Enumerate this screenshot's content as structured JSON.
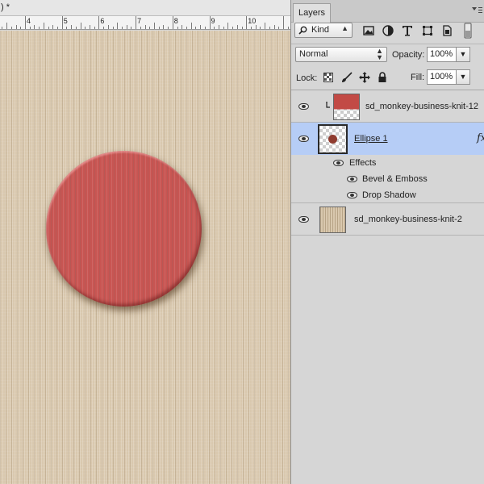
{
  "document": {
    "title_fragment": ") *"
  },
  "ruler": {
    "labels": [
      "4",
      "5",
      "6",
      "7",
      "8",
      "9",
      "10"
    ]
  },
  "panel": {
    "tab_label": "Layers",
    "filter": {
      "kind_label": "Kind"
    },
    "blend_mode": "Normal",
    "opacity_label": "Opacity:",
    "opacity_value": "100%",
    "lock_label": "Lock:",
    "fill_label": "Fill:",
    "fill_value": "100%",
    "layers": [
      {
        "name": "sd_monkey-business-knit-12",
        "clipped": true,
        "selected": false
      },
      {
        "name": "Ellipse 1",
        "selected": true,
        "fx": "fx",
        "effects_label": "Effects",
        "effects": [
          "Bevel & Emboss",
          "Drop Shadow"
        ]
      },
      {
        "name": "sd_monkey-business-knit-2",
        "selected": false
      }
    ]
  },
  "icons": [
    "search-icon",
    "image-filter-icon",
    "adjustment-filter-icon",
    "type-filter-icon",
    "shape-filter-icon",
    "smart-object-filter-icon",
    "filter-toggle-icon",
    "lock-transparent-icon",
    "lock-paint-icon",
    "lock-move-icon",
    "lock-all-icon",
    "eye-icon",
    "clip-arrow-icon",
    "fx-icon"
  ],
  "colors": {
    "canvas_bg": "#d9c8ae",
    "circle": "#c85552",
    "selection": "#b6cdf6"
  }
}
